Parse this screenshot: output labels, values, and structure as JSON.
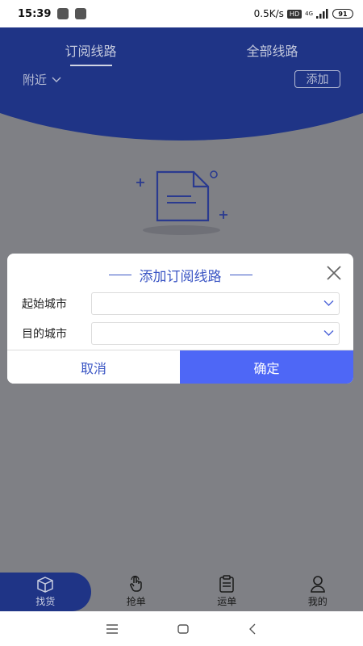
{
  "status_bar": {
    "time": "15:39",
    "network_speed": "0.5K/s",
    "hd_badge": "HD",
    "network_type": "4G",
    "battery": "91"
  },
  "header": {
    "tabs": [
      {
        "label": "订阅线路",
        "active": true
      },
      {
        "label": "全部线路",
        "active": false
      }
    ],
    "nearby_label": "附近",
    "add_label": "添加"
  },
  "dialog": {
    "title": "添加订阅线路",
    "fields": [
      {
        "label": "起始城市",
        "value": ""
      },
      {
        "label": "目的城市",
        "value": ""
      }
    ],
    "cancel_label": "取消",
    "confirm_label": "确定"
  },
  "bottom_nav": [
    {
      "label": "找货",
      "icon": "box-icon",
      "active": true
    },
    {
      "label": "抢单",
      "icon": "tap-hand-icon",
      "active": false
    },
    {
      "label": "运单",
      "icon": "clipboard-icon",
      "active": false
    },
    {
      "label": "我的",
      "icon": "user-icon",
      "active": false
    }
  ],
  "colors": {
    "brand_blue": "#1f3486",
    "accent_blue": "#4e67f6",
    "title_blue": "#3a55c4",
    "overlay_gray": "#7f8085"
  }
}
